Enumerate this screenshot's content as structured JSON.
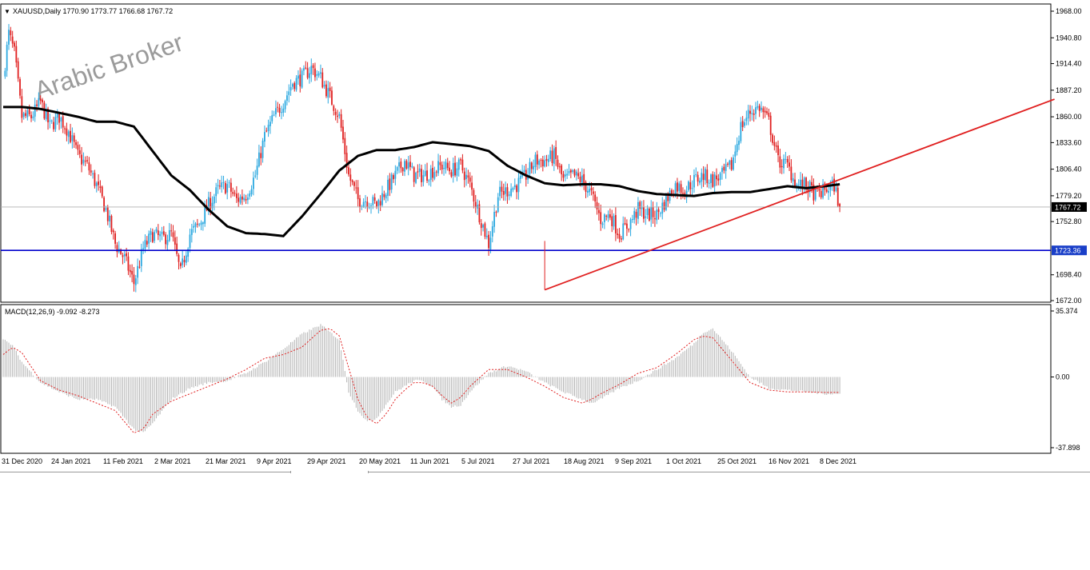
{
  "header": {
    "menu_glyph": "▼",
    "symbol_info": "XAUUSD,Daily  1770.90 1773.77 1766.68 1767.72"
  },
  "watermark": "Arabic Broker",
  "colors": {
    "bull": "#2aa8e0",
    "bear": "#e02020",
    "ma": "#000000",
    "trendline": "#e02020",
    "support": "#0000cc",
    "price_tag_bg": "#000000",
    "support_tag_bg": "#1a3fc8",
    "macd_hist": "#b4b4b4",
    "macd_signal": "#e02020"
  },
  "chart_data": [
    {
      "type": "candlestick",
      "symbol": "XAUUSD",
      "timeframe": "Daily",
      "ohlc_last": {
        "open": 1770.9,
        "high": 1773.77,
        "low": 1766.68,
        "close": 1767.72
      },
      "y_ticks": [
        "1968.00",
        "1940.80",
        "1914.40",
        "1887.20",
        "1860.00",
        "1833.60",
        "1806.40",
        "1779.20",
        "1752.80",
        "1698.40",
        "1672.00"
      ],
      "ylim": [
        1672.0,
        1968.0
      ],
      "x_ticks": [
        "31 Dec 2020",
        "24 Jan 2021",
        "11 Feb 2021",
        "2 Mar 2021",
        "21 Mar 2021",
        "9 Apr 2021",
        "29 Apr 2021",
        "20 May 2021",
        "11 Jun 2021",
        "5 Jul 2021",
        "27 Jul 2021",
        "18 Aug 2021",
        "9 Sep 2021",
        "1 Oct 2021",
        "25 Oct 2021",
        "16 Nov 2021",
        "8 Dec 2021"
      ],
      "close_path": [
        [
          0,
          1900
        ],
        [
          3,
          1945
        ],
        [
          6,
          1925
        ],
        [
          10,
          1860
        ],
        [
          15,
          1860
        ],
        [
          20,
          1875
        ],
        [
          25,
          1850
        ],
        [
          30,
          1860
        ],
        [
          35,
          1845
        ],
        [
          40,
          1820
        ],
        [
          45,
          1810
        ],
        [
          50,
          1790
        ],
        [
          55,
          1765
        ],
        [
          60,
          1730
        ],
        [
          65,
          1715
        ],
        [
          70,
          1690
        ],
        [
          75,
          1725
        ],
        [
          80,
          1740
        ],
        [
          85,
          1735
        ],
        [
          90,
          1740
        ],
        [
          95,
          1700
        ],
        [
          100,
          1740
        ],
        [
          105,
          1750
        ],
        [
          110,
          1770
        ],
        [
          115,
          1785
        ],
        [
          120,
          1790
        ],
        [
          125,
          1775
        ],
        [
          130,
          1780
        ],
        [
          135,
          1800
        ],
        [
          140,
          1840
        ],
        [
          145,
          1860
        ],
        [
          150,
          1875
        ],
        [
          155,
          1895
        ],
        [
          160,
          1900
        ],
        [
          165,
          1910
        ],
        [
          170,
          1900
        ],
        [
          175,
          1880
        ],
        [
          180,
          1860
        ],
        [
          185,
          1800
        ],
        [
          190,
          1775
        ],
        [
          195,
          1775
        ],
        [
          200,
          1770
        ],
        [
          205,
          1785
        ],
        [
          210,
          1800
        ],
        [
          215,
          1815
        ],
        [
          220,
          1800
        ],
        [
          225,
          1800
        ],
        [
          230,
          1805
        ],
        [
          235,
          1810
        ],
        [
          240,
          1805
        ],
        [
          245,
          1810
        ],
        [
          250,
          1790
        ],
        [
          255,
          1760
        ],
        [
          260,
          1730
        ],
        [
          265,
          1780
        ],
        [
          270,
          1785
        ],
        [
          275,
          1790
        ],
        [
          280,
          1800
        ],
        [
          285,
          1815
        ],
        [
          290,
          1815
        ],
        [
          295,
          1820
        ],
        [
          300,
          1795
        ],
        [
          305,
          1800
        ],
        [
          310,
          1795
        ],
        [
          315,
          1780
        ],
        [
          320,
          1755
        ],
        [
          325,
          1760
        ],
        [
          330,
          1740
        ],
        [
          335,
          1750
        ],
        [
          340,
          1765
        ],
        [
          345,
          1760
        ],
        [
          350,
          1760
        ],
        [
          355,
          1775
        ],
        [
          360,
          1790
        ],
        [
          365,
          1785
        ],
        [
          370,
          1795
        ],
        [
          375,
          1800
        ],
        [
          380,
          1795
        ],
        [
          385,
          1800
        ],
        [
          390,
          1810
        ],
        [
          395,
          1850
        ],
        [
          400,
          1865
        ],
        [
          405,
          1870
        ],
        [
          410,
          1855
        ],
        [
          415,
          1815
        ],
        [
          420,
          1810
        ],
        [
          425,
          1790
        ],
        [
          430,
          1790
        ],
        [
          435,
          1780
        ],
        [
          440,
          1785
        ],
        [
          445,
          1790
        ],
        [
          448,
          1768
        ]
      ],
      "ma_path": [
        [
          0,
          1870
        ],
        [
          10,
          1870
        ],
        [
          20,
          1868
        ],
        [
          40,
          1860
        ],
        [
          50,
          1855
        ],
        [
          60,
          1855
        ],
        [
          70,
          1850
        ],
        [
          80,
          1825
        ],
        [
          90,
          1800
        ],
        [
          100,
          1785
        ],
        [
          110,
          1765
        ],
        [
          120,
          1748
        ],
        [
          130,
          1741
        ],
        [
          140,
          1740
        ],
        [
          150,
          1738
        ],
        [
          160,
          1758
        ],
        [
          170,
          1781
        ],
        [
          180,
          1805
        ],
        [
          190,
          1820
        ],
        [
          200,
          1826
        ],
        [
          210,
          1826
        ],
        [
          220,
          1829
        ],
        [
          230,
          1834
        ],
        [
          240,
          1832
        ],
        [
          250,
          1830
        ],
        [
          260,
          1825
        ],
        [
          270,
          1810
        ],
        [
          280,
          1800
        ],
        [
          290,
          1792
        ],
        [
          300,
          1790
        ],
        [
          310,
          1791
        ],
        [
          320,
          1791
        ],
        [
          330,
          1789
        ],
        [
          340,
          1784
        ],
        [
          350,
          1781
        ],
        [
          360,
          1780
        ],
        [
          370,
          1779
        ],
        [
          380,
          1782
        ],
        [
          390,
          1783
        ],
        [
          400,
          1783
        ],
        [
          410,
          1786
        ],
        [
          420,
          1789
        ],
        [
          430,
          1787
        ],
        [
          440,
          1789
        ],
        [
          448,
          1791
        ]
      ],
      "trendline": {
        "from": {
          "bar": 290,
          "price": 1683
        },
        "to": {
          "bar": 563,
          "price": 1878
        }
      },
      "support_line": 1723.36,
      "current_price": 1767.72,
      "price_labels": {
        "current": "1767.72",
        "support": "1723.36"
      }
    },
    {
      "type": "bar",
      "indicator": "MACD",
      "header": "MACD(12,26,9) -9.092 -8.273",
      "y_ticks": [
        "35.374",
        "0.00",
        "-37.898"
      ],
      "ylim": [
        -37.898,
        35.374
      ],
      "hist_path": [
        [
          0,
          20
        ],
        [
          5,
          17
        ],
        [
          10,
          8
        ],
        [
          20,
          -3
        ],
        [
          30,
          -8
        ],
        [
          40,
          -12
        ],
        [
          50,
          -12
        ],
        [
          60,
          -16
        ],
        [
          65,
          -22
        ],
        [
          70,
          -28
        ],
        [
          75,
          -30
        ],
        [
          80,
          -25
        ],
        [
          90,
          -12
        ],
        [
          100,
          -6
        ],
        [
          110,
          -3
        ],
        [
          120,
          -2
        ],
        [
          130,
          2
        ],
        [
          140,
          8
        ],
        [
          150,
          15
        ],
        [
          160,
          23
        ],
        [
          170,
          28
        ],
        [
          175,
          24
        ],
        [
          180,
          20
        ],
        [
          185,
          -8
        ],
        [
          190,
          -18
        ],
        [
          195,
          -24
        ],
        [
          200,
          -22
        ],
        [
          205,
          -15
        ],
        [
          210,
          -8
        ],
        [
          215,
          -5
        ],
        [
          220,
          -2
        ],
        [
          225,
          -2
        ],
        [
          230,
          -5
        ],
        [
          235,
          -12
        ],
        [
          240,
          -16
        ],
        [
          245,
          -15
        ],
        [
          250,
          -8
        ],
        [
          260,
          2
        ],
        [
          270,
          6
        ],
        [
          280,
          3
        ],
        [
          290,
          -3
        ],
        [
          300,
          -8
        ],
        [
          310,
          -12
        ],
        [
          315,
          -14
        ],
        [
          320,
          -12
        ],
        [
          330,
          -6
        ],
        [
          340,
          -2
        ],
        [
          350,
          4
        ],
        [
          360,
          10
        ],
        [
          370,
          18
        ],
        [
          375,
          24
        ],
        [
          380,
          26
        ],
        [
          390,
          14
        ],
        [
          400,
          0
        ],
        [
          410,
          -6
        ],
        [
          420,
          -7
        ],
        [
          430,
          -8
        ],
        [
          440,
          -9
        ],
        [
          448,
          -9.092
        ]
      ],
      "signal_path": [
        [
          0,
          12
        ],
        [
          5,
          16
        ],
        [
          10,
          13
        ],
        [
          20,
          -2
        ],
        [
          30,
          -7
        ],
        [
          40,
          -10
        ],
        [
          50,
          -14
        ],
        [
          60,
          -18
        ],
        [
          65,
          -24
        ],
        [
          70,
          -30
        ],
        [
          75,
          -28
        ],
        [
          80,
          -20
        ],
        [
          90,
          -13
        ],
        [
          100,
          -9
        ],
        [
          110,
          -5
        ],
        [
          120,
          -1
        ],
        [
          130,
          4
        ],
        [
          140,
          10
        ],
        [
          150,
          12
        ],
        [
          160,
          16
        ],
        [
          170,
          25
        ],
        [
          175,
          26
        ],
        [
          180,
          22
        ],
        [
          185,
          5
        ],
        [
          190,
          -12
        ],
        [
          195,
          -22
        ],
        [
          200,
          -25
        ],
        [
          205,
          -20
        ],
        [
          210,
          -12
        ],
        [
          215,
          -7
        ],
        [
          220,
          -3
        ],
        [
          225,
          -3
        ],
        [
          230,
          -5
        ],
        [
          235,
          -10
        ],
        [
          240,
          -14
        ],
        [
          245,
          -11
        ],
        [
          250,
          -5
        ],
        [
          260,
          4
        ],
        [
          270,
          4
        ],
        [
          280,
          0
        ],
        [
          290,
          -5
        ],
        [
          300,
          -11
        ],
        [
          310,
          -14
        ],
        [
          315,
          -12
        ],
        [
          320,
          -9
        ],
        [
          330,
          -4
        ],
        [
          340,
          2
        ],
        [
          350,
          5
        ],
        [
          360,
          12
        ],
        [
          370,
          20
        ],
        [
          375,
          22
        ],
        [
          380,
          21
        ],
        [
          390,
          9
        ],
        [
          400,
          -3
        ],
        [
          410,
          -7
        ],
        [
          420,
          -8
        ],
        [
          430,
          -8
        ],
        [
          440,
          -8.3
        ],
        [
          448,
          -8.273
        ]
      ]
    }
  ]
}
